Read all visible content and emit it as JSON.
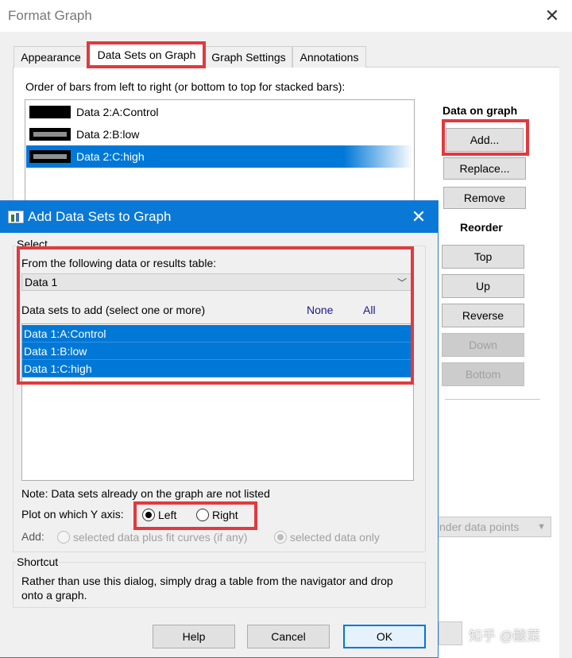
{
  "outer": {
    "title": "Format Graph",
    "close": "✕",
    "tabs": [
      {
        "label": "Appearance"
      },
      {
        "label": "Data Sets on Graph"
      },
      {
        "label": "Graph Settings"
      },
      {
        "label": "Annotations"
      }
    ],
    "order_label": "Order of bars from left to right (or bottom to top for stacked bars):",
    "order_items": [
      {
        "label": "Data 2:A:Control",
        "swatch": "solid"
      },
      {
        "label": "Data 2:B:low",
        "swatch": "gray"
      },
      {
        "label": "Data 2:C:high",
        "swatch": "gray"
      }
    ],
    "data_on_graph": "Data on graph",
    "add": "Add...",
    "replace": "Replace...",
    "remove": "Remove",
    "reorder": "Reorder",
    "top": "Top",
    "up": "Up",
    "reverse": "Reverse",
    "down": "Down",
    "bottom": "Bottom",
    "dropdown_partial": "nder data points",
    "watermark": "知乎 @酸菜"
  },
  "dialog": {
    "title": "Add Data Sets to Graph",
    "close": "✕",
    "select_group": "Select",
    "from_label": "From the following data or results table:",
    "table_value": "Data 1",
    "datasets_label": "Data sets to add (select one or more)",
    "none": "None",
    "all": "All",
    "datasets": [
      {
        "label": "Data 1:A:Control"
      },
      {
        "label": "Data 1:B:low"
      },
      {
        "label": "Data 1:C:high"
      }
    ],
    "note": "Note: Data sets already on the graph are not listed",
    "yaxis_label": "Plot on which Y axis:",
    "left": "Left",
    "right": "Right",
    "add_label": "Add:",
    "option_fit": "selected data plus fit curves (if any)",
    "option_data": "selected data only",
    "shortcut_group": "Shortcut",
    "shortcut_text": "Rather than use this dialog, simply drag a table from the navigator and drop onto a graph.",
    "help": "Help",
    "cancel": "Cancel",
    "ok": "OK"
  },
  "colors": {
    "selection": "#0078d7",
    "highlight": "#e03a3e",
    "dialog_title": "#0a78d7"
  }
}
